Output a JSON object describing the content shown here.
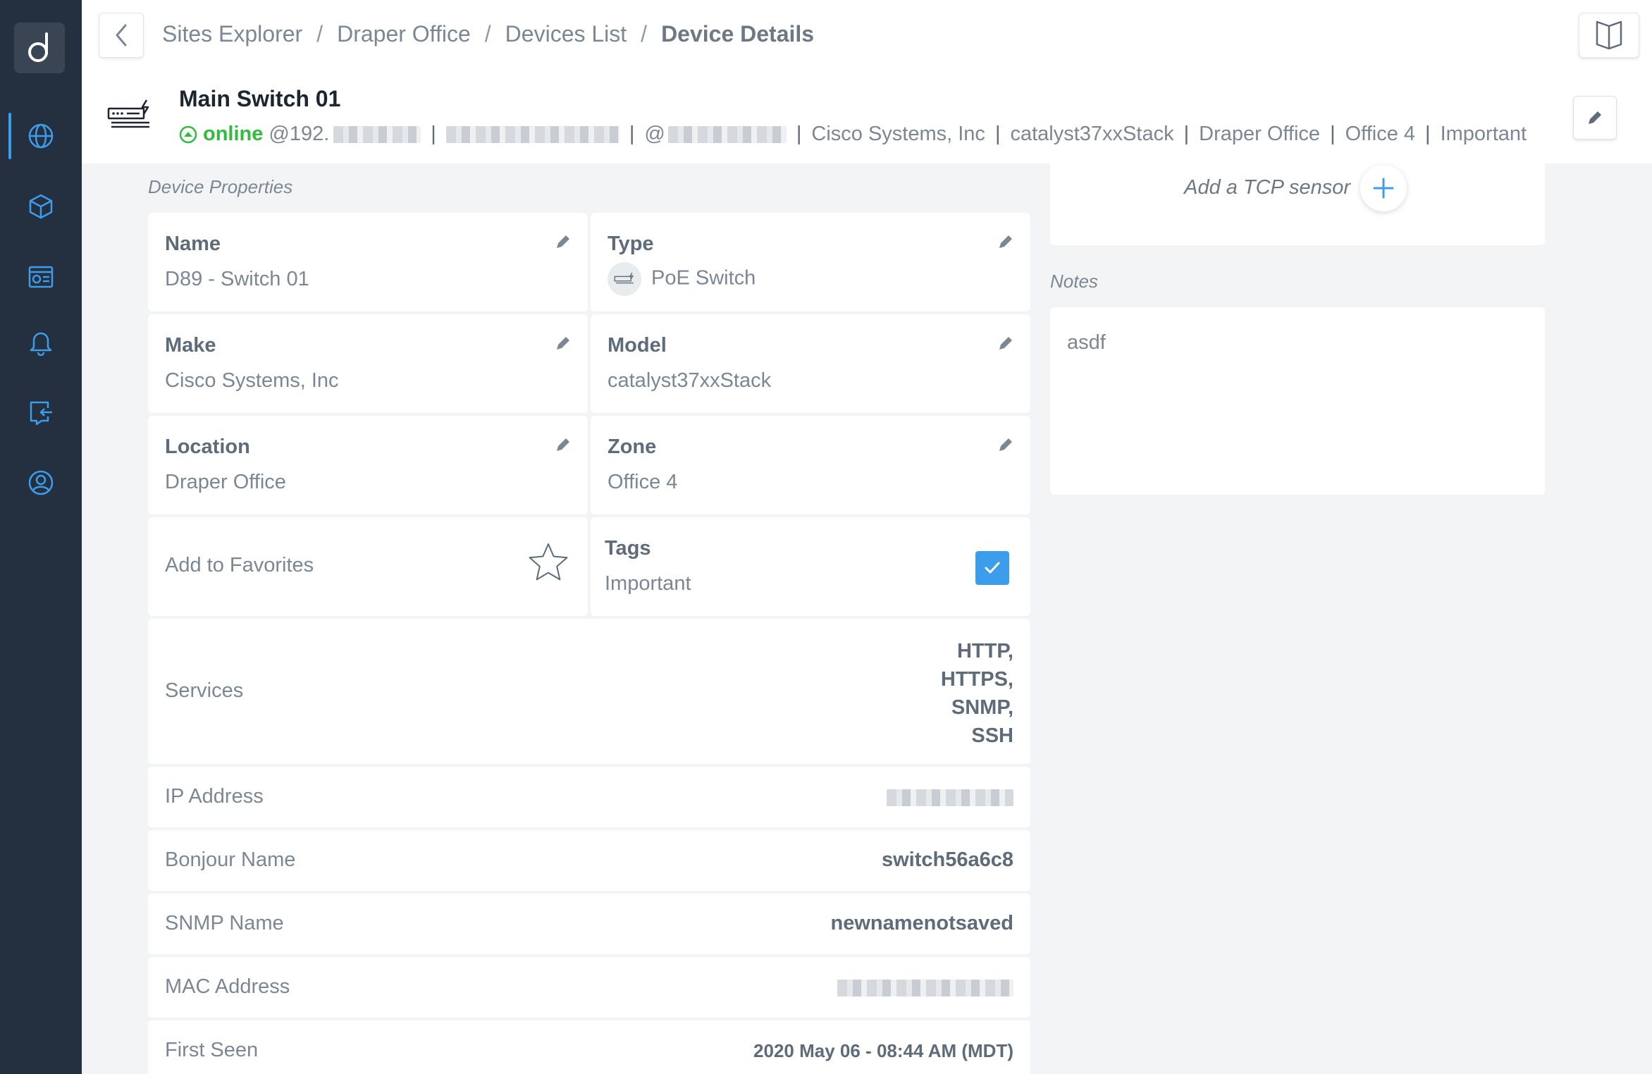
{
  "breadcrumb": [
    "Sites Explorer",
    "Draper Office",
    "Devices List",
    "Device Details"
  ],
  "device": {
    "title": "Main Switch 01",
    "status": "online",
    "ip_prefix": "@192.",
    "at": "@",
    "make": "Cisco Systems, Inc",
    "model": "catalyst37xxStack",
    "location": "Draper Office",
    "zone": "Office 4",
    "tag": "Important"
  },
  "properties": {
    "section_title": "Device Properties",
    "name_label": "Name",
    "name_value": "D89 - Switch 01",
    "type_label": "Type",
    "type_value": "PoE Switch",
    "make_label": "Make",
    "make_value": "Cisco Systems, Inc",
    "model_label": "Model",
    "model_value": "catalyst37xxStack",
    "location_label": "Location",
    "location_value": "Draper Office",
    "zone_label": "Zone",
    "zone_value": "Office 4",
    "favorites_label": "Add to Favorites",
    "tags_label": "Tags",
    "tags_value": "Important",
    "services_label": "Services",
    "services": [
      "HTTP,",
      "HTTPS,",
      "SNMP,",
      "SSH"
    ],
    "ip_label": "IP Address",
    "bonjour_label": "Bonjour Name",
    "bonjour_value": "switch56a6c8",
    "snmp_label": "SNMP Name",
    "snmp_value": "newnamenotsaved",
    "mac_label": "MAC Address",
    "first_seen_label": "First Seen",
    "first_seen_value": "2020 May 06 - 08:44 AM (MDT)"
  },
  "sensor": {
    "add_label": "Add a TCP sensor"
  },
  "notes": {
    "section_title": "Notes",
    "text": "asdf"
  },
  "colors": {
    "accent": "#3c9dea",
    "online": "#2fbd3a",
    "sidebar": "#243040"
  },
  "icons": [
    "logo-icon",
    "globe-icon",
    "cube-icon",
    "dashboard-icon",
    "bell-icon",
    "export-icon",
    "user-icon",
    "back-icon",
    "book-icon",
    "switch-icon",
    "pencil-icon",
    "star-icon",
    "check-icon",
    "plus-icon"
  ]
}
